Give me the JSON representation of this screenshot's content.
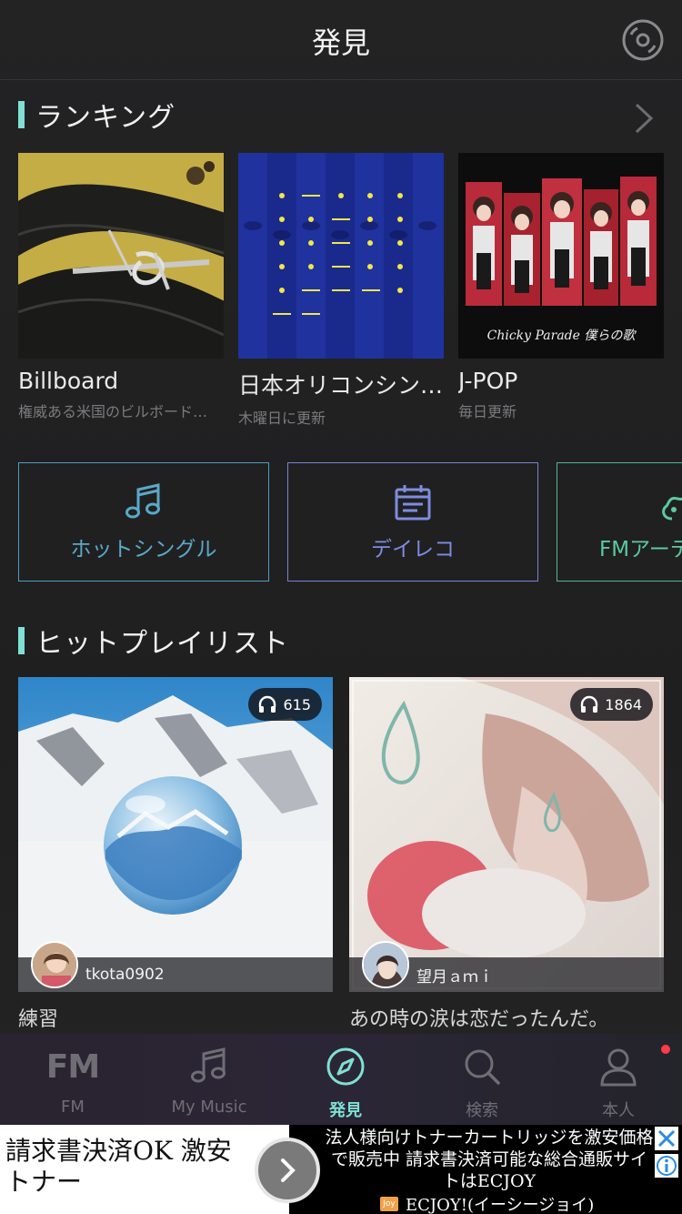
{
  "header": {
    "title": "発見"
  },
  "ranking": {
    "title": "ランキング",
    "cards": [
      {
        "title": "Billboard",
        "subtitle": "権威ある米国のビルボード…"
      },
      {
        "title": "日本オリコンシン…",
        "subtitle": "木曜日に更新"
      },
      {
        "title": "J-POP",
        "subtitle": "毎日更新"
      }
    ],
    "cover3_caption": "Chicky Parade 僕らの歌"
  },
  "categories": [
    {
      "label": "ホットシングル",
      "icon": "music-note-icon",
      "color": "#5aa9c8"
    },
    {
      "label": "デイレコ",
      "icon": "calendar-icon",
      "color": "#7d8de0"
    },
    {
      "label": "FMアーティスト",
      "icon": "guitar-icon",
      "color": "#5cc9a0"
    }
  ],
  "playlists": {
    "title": "ヒットプレイリスト",
    "items": [
      {
        "plays": "615",
        "user": "tkota0902",
        "title": "練習"
      },
      {
        "plays": "1864",
        "user": "望月ａｍｉ",
        "title": "あの時の涙は恋だったんだ。"
      }
    ]
  },
  "tabs": [
    {
      "label": "FM",
      "icon": "fm-icon"
    },
    {
      "label": "My Music",
      "icon": "music-note-icon"
    },
    {
      "label": "発見",
      "icon": "compass-icon",
      "active": true
    },
    {
      "label": "検索",
      "icon": "search-icon"
    },
    {
      "label": "本人",
      "icon": "person-icon"
    }
  ],
  "ad": {
    "left_text": "請求書決済OK 激安トナー",
    "right_text": "法人様向けトナーカートリッジを激安価格で販売中 請求書決済可能な総合通販サイトはECJOY",
    "brand": "ECJOY!(イーシージョイ)",
    "brand_logo": "Joy"
  },
  "colors": {
    "accent": "#7fe0d6",
    "background": "#1f1f20",
    "badge": "#ff3b4a"
  }
}
